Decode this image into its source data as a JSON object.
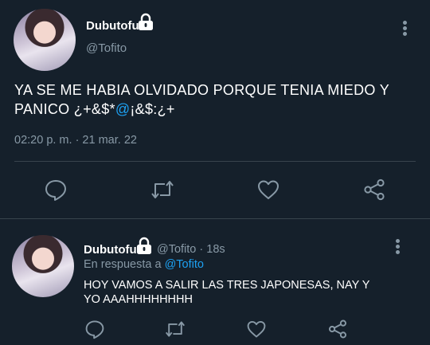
{
  "main_tweet": {
    "display_name": "Dubutofu",
    "handle": "@Tofito",
    "text_before": "YA SE ME HABIA OLVIDADO PORQUE TENIA MIEDO Y PANICO ¿+&$*",
    "text_mention": "@",
    "text_after": "¡&$:¿+",
    "timestamp": "02:20 p. m. · 21 mar. 22"
  },
  "reply_tweet": {
    "display_name": "Dubutofu",
    "handle_time": "@Tofito · 18s",
    "replying_prefix": "En respuesta a",
    "replying_to": "@Tofito",
    "text": "HOY VAMOS A SALIR LAS TRES JAPONESAS, NAY Y YO AAAHHHHHHHH"
  },
  "icons": [
    "lock-icon",
    "more-icon",
    "reply-icon",
    "retweet-icon",
    "like-icon",
    "share-icon"
  ],
  "colors": {
    "background": "#15202b",
    "secondary_text": "#8899a6",
    "accent": "#1da1f2",
    "divider": "#38444d"
  }
}
